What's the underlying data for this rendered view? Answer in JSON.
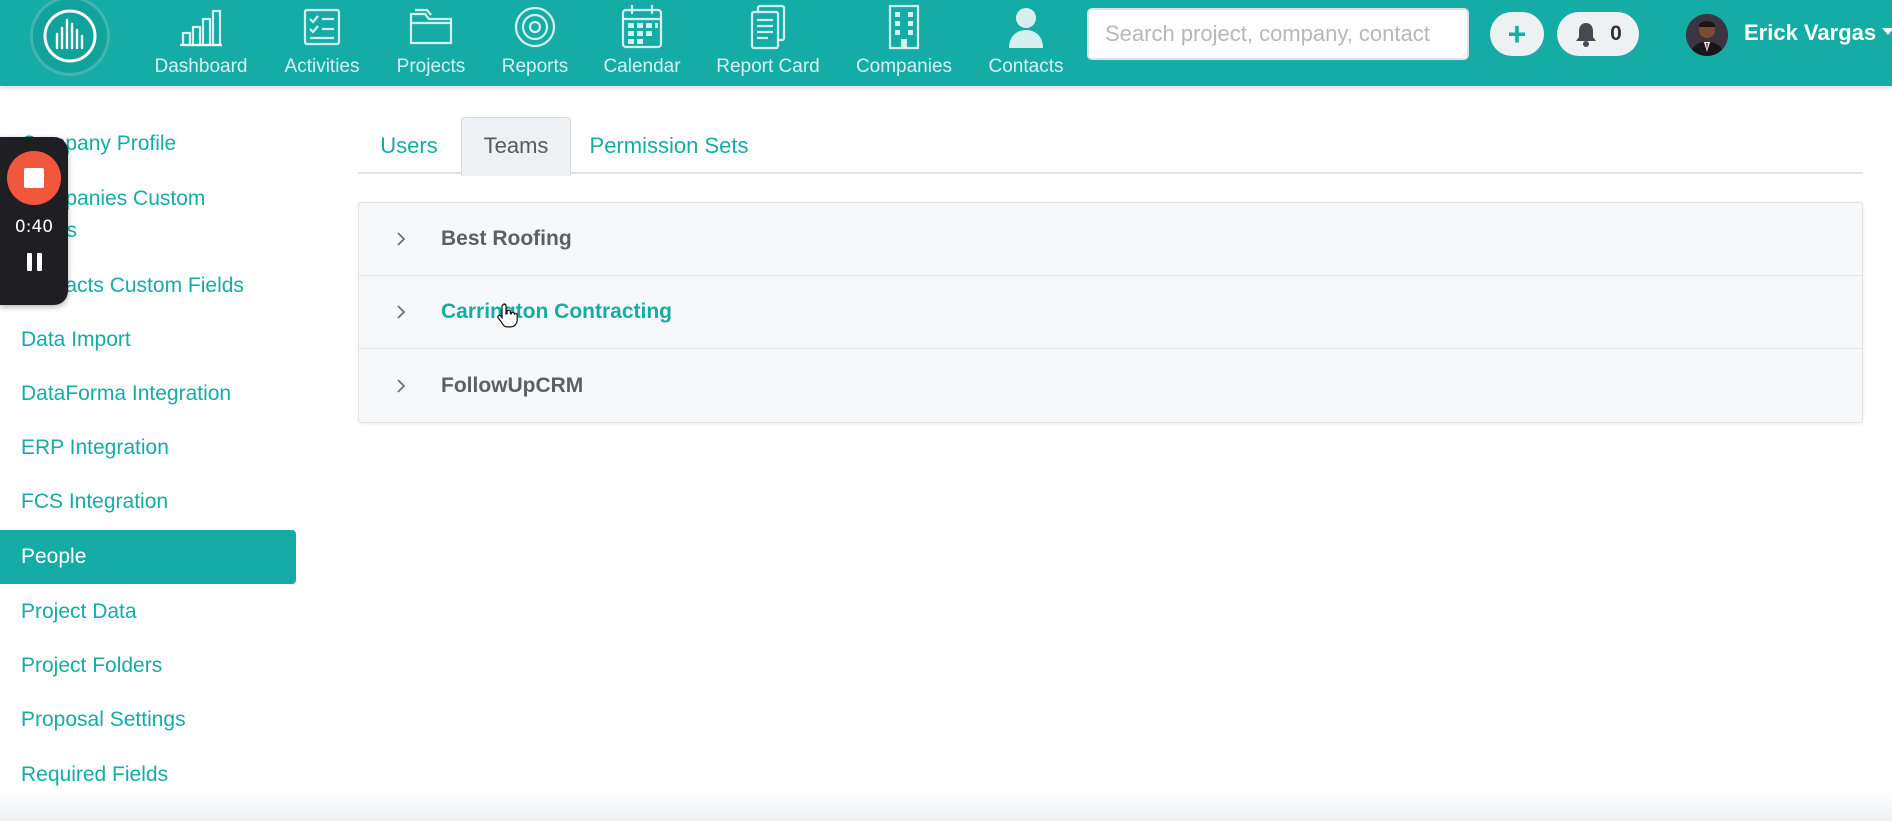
{
  "topbar": {
    "brand_color": "#16aca6",
    "nav": [
      {
        "label": "Dashboard",
        "icon": "bar-chart-icon"
      },
      {
        "label": "Activities",
        "icon": "checklist-icon"
      },
      {
        "label": "Projects",
        "icon": "folder-icon"
      },
      {
        "label": "Reports",
        "icon": "target-icon"
      },
      {
        "label": "Calendar",
        "icon": "calendar-icon"
      },
      {
        "label": "Report Card",
        "icon": "document-icon"
      },
      {
        "label": "Companies",
        "icon": "building-icon"
      },
      {
        "label": "Contacts",
        "icon": "person-icon"
      }
    ],
    "search": {
      "placeholder": "Search project, company, contact",
      "value": ""
    },
    "add_label": "+",
    "notifications_count": "0",
    "user_name": "Erick Vargas"
  },
  "recorder": {
    "time": "0:40"
  },
  "sidebar": {
    "items": [
      {
        "label": "Company Profile",
        "active": false
      },
      {
        "label": "Companies Custom Fields",
        "active": false
      },
      {
        "label": "Contacts Custom Fields",
        "active": false
      },
      {
        "label": "Data Import",
        "active": false
      },
      {
        "label": "DataForma Integration",
        "active": false
      },
      {
        "label": "ERP Integration",
        "active": false
      },
      {
        "label": "FCS Integration",
        "active": false
      },
      {
        "label": "People",
        "active": true
      },
      {
        "label": "Project Data",
        "active": false
      },
      {
        "label": "Project Folders",
        "active": false
      },
      {
        "label": "Proposal Settings",
        "active": false
      },
      {
        "label": "Required Fields",
        "active": false
      }
    ]
  },
  "tabs": [
    {
      "label": "Users",
      "active": false
    },
    {
      "label": "Teams",
      "active": true
    },
    {
      "label": "Permission Sets",
      "active": false
    }
  ],
  "teams": [
    {
      "name": "Best Roofing"
    },
    {
      "name": "Carrington Contracting"
    },
    {
      "name": "FollowUpCRM"
    }
  ]
}
